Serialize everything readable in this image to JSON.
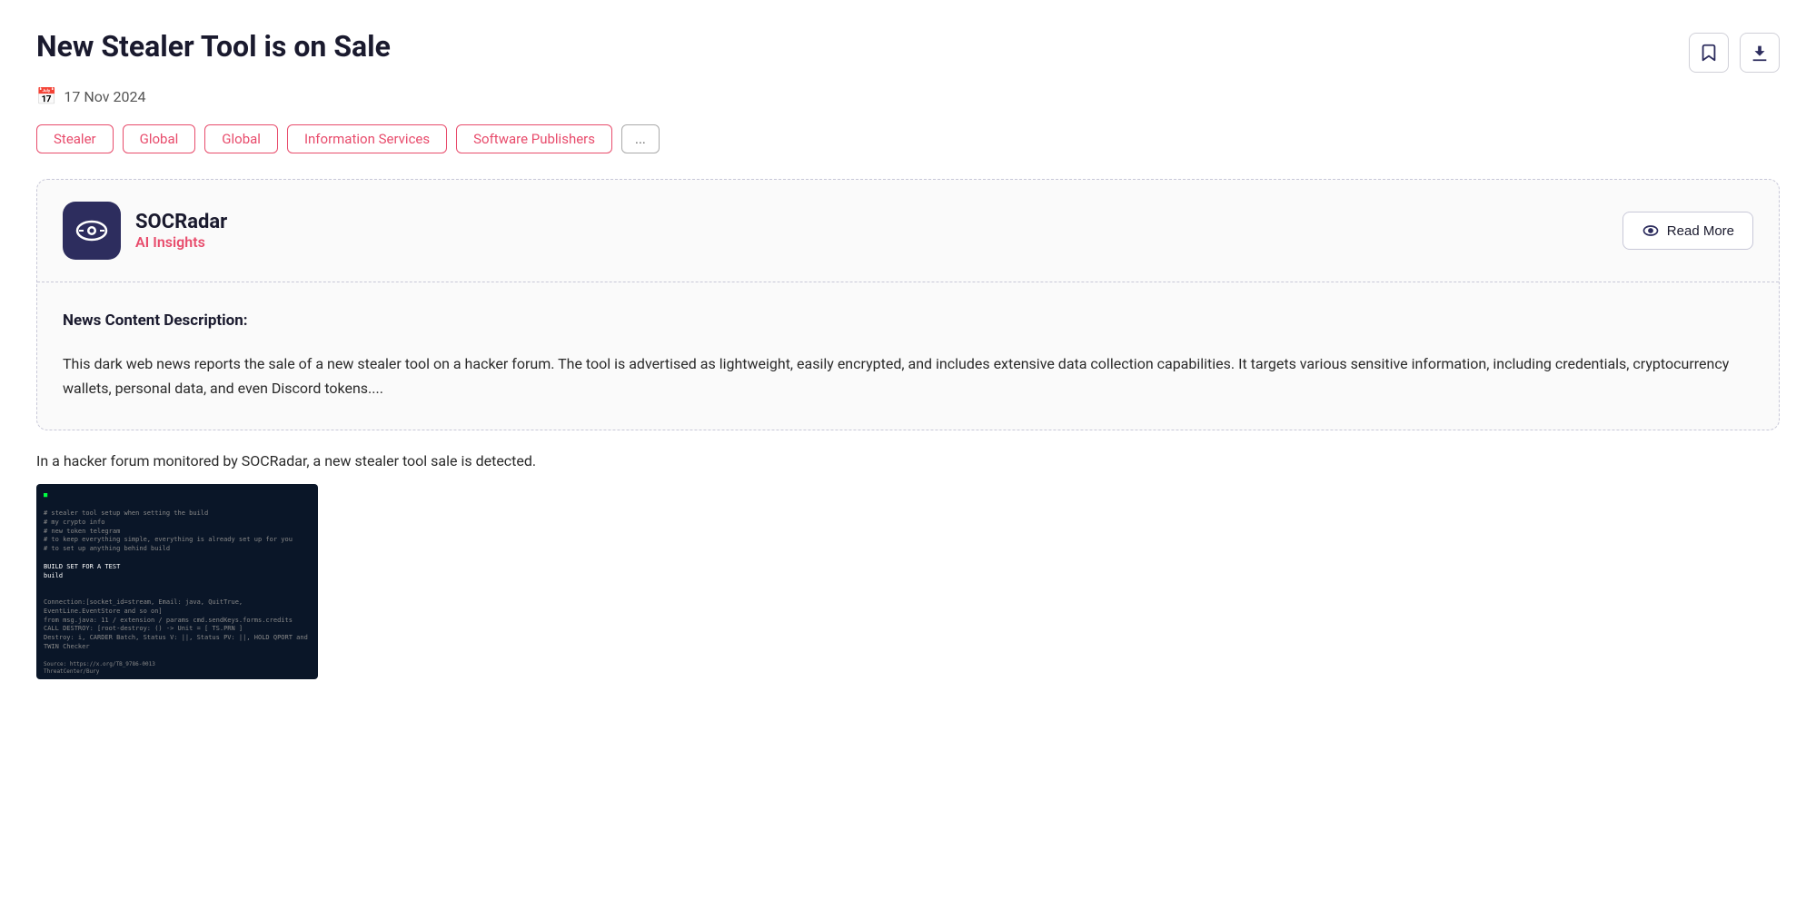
{
  "page": {
    "title": "New Stealer Tool is on Sale",
    "date": "17 Nov 2024",
    "date_icon": "📅"
  },
  "header_actions": {
    "bookmark_label": "bookmark",
    "download_label": "download"
  },
  "tags": [
    {
      "label": "Stealer",
      "type": "accent"
    },
    {
      "label": "Global",
      "type": "accent"
    },
    {
      "label": "Global",
      "type": "accent"
    },
    {
      "label": "Information Services",
      "type": "accent"
    },
    {
      "label": "Software Publishers",
      "type": "accent"
    },
    {
      "label": "...",
      "type": "more"
    }
  ],
  "ai_card": {
    "brand_name": "SOCRadar",
    "brand_sub": "AI Insights",
    "read_more_label": "Read More",
    "content_label": "News Content Description:",
    "content_text": "This dark web news reports the sale of a new stealer tool on a hacker forum. The tool is advertised as lightweight, easily encrypted, and includes extensive data collection capabilities. It targets various sensitive information, including credentials, cryptocurrency wallets, personal data, and even Discord tokens...."
  },
  "subtitle": "In a hacker forum monitored by SOCRadar, a new stealer tool sale is detected.",
  "terminal": {
    "lines": [
      "# stealer tool setup when setting the build",
      "# my crypto info",
      "# new token telegram",
      "# to keep everything simple, everything is already set up for you",
      "# to set up anything behind build",
      "",
      "BUILD SET FOR A TEST",
      "build",
      "",
      "",
      "Connection: [socket_id=stream, Email: java, QuitTrue, EventLine.EventStore and so on]",
      "from msg.java: 11 / extension / params cmd.sendKeys.forms.credits",
      "CALL DESTROY: [root-destroy: () -> Unit = [ TS.PRN ]",
      "CALL Destroy: i, CARDER Batch, Status V: ||, Status PV: ||, HOLD QPORT and TWIN Checker"
    ]
  }
}
